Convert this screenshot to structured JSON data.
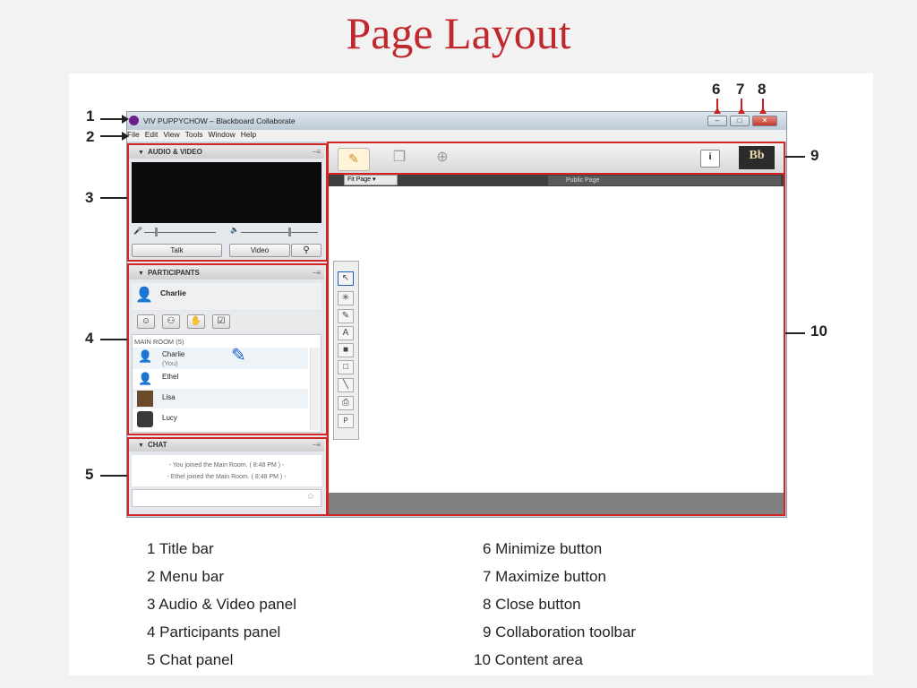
{
  "slide": {
    "title": "Page Layout"
  },
  "window": {
    "title": "VIV PUPPYCHOW – Blackboard Collaborate",
    "menu": [
      "File",
      "Edit",
      "View",
      "Tools",
      "Window",
      "Help"
    ],
    "min_glyph": "–",
    "max_glyph": "□",
    "close_glyph": "✕"
  },
  "audio_video": {
    "title": "AUDIO & VIDEO",
    "controls": "−≡",
    "talk_label": "Talk",
    "video_label": "Video"
  },
  "participants": {
    "title": "PARTICIPANTS",
    "controls": "−≡",
    "me": "Charlie",
    "room_label": "MAIN ROOM (5)",
    "list": [
      {
        "name": "Charlie",
        "sub": "(You)"
      },
      {
        "name": "Ethel",
        "sub": ""
      },
      {
        "name": "Lisa",
        "sub": ""
      },
      {
        "name": "Lucy",
        "sub": ""
      }
    ]
  },
  "chat": {
    "title": "CHAT",
    "controls": "−≡",
    "messages": [
      "- You joined the Main Room. ( 8:48 PM ) -",
      "- Ethel joined the Main Room. ( 8:48 PM ) -"
    ]
  },
  "content": {
    "fit_page": "Fit Page",
    "public_page": "Public Page",
    "info_glyph": "i",
    "bb_logo": "Bb"
  },
  "callouts": [
    "1",
    "2",
    "3",
    "4",
    "5",
    "6",
    "7",
    "8",
    "9",
    "10"
  ],
  "legend_left": [
    "1 Title bar",
    "2 Menu bar",
    "3 Audio & Video panel",
    "4 Participants panel",
    "5 Chat panel"
  ],
  "legend_right": [
    "6 Minimize button",
    "7 Maximize button",
    "8 Close button",
    "9 Collaboration toolbar",
    "10 Content area"
  ],
  "colors": {
    "title_red": "#c0282d",
    "highlight_red": "#d42525",
    "app_purple": "#6b1f8a"
  }
}
